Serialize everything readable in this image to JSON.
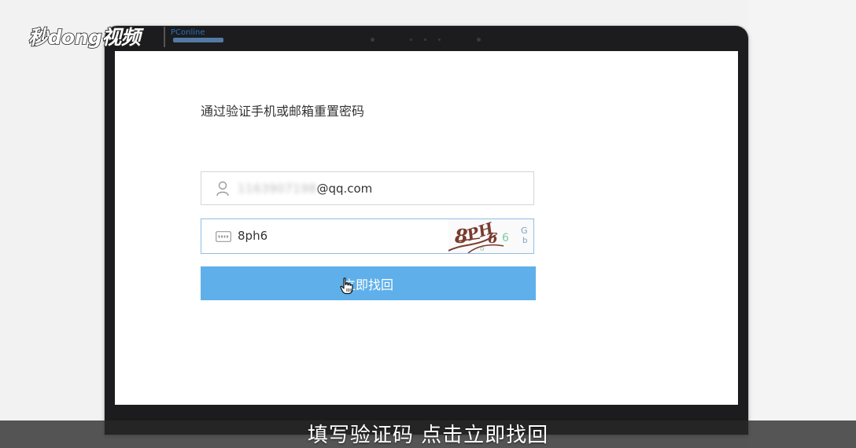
{
  "watermark": {
    "logo_text": "秒dong视频",
    "partner_logo_text": "PConline"
  },
  "page": {
    "heading": "通过验证手机或邮箱重置密码"
  },
  "form": {
    "account_field": {
      "value_blurred": "1163907198",
      "value_visible": "@qq.com",
      "icon": "user-icon"
    },
    "captcha_field": {
      "value": "8ph6",
      "icon": "captcha-icon",
      "captcha_image_text": "8PH6"
    },
    "submit_label": "立即找回"
  },
  "caption": "填写验证码 点击立即找回"
}
